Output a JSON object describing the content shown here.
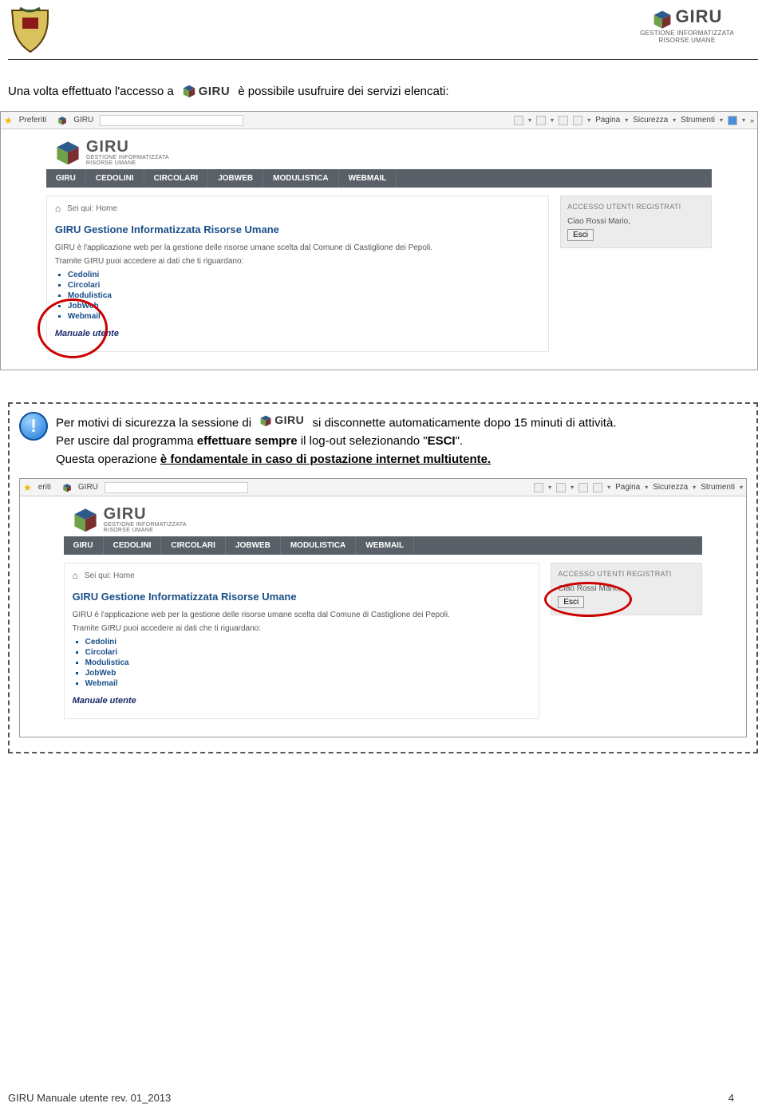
{
  "header": {
    "brand_title": "GIRU",
    "brand_sub1": "GESTIONE INFORMATIZZATA",
    "brand_sub2": "RISORSE UMANE"
  },
  "intro": {
    "part1": "Una volta effettuato l'accesso a",
    "part2": "è  possibile  usufruire  dei  servizi elencati:"
  },
  "screenshot": {
    "ie": {
      "preferiti": "Preferiti",
      "giru_tab": "GIRU",
      "pagina": "Pagina",
      "sicurezza": "Sicurezza",
      "strumenti": "Strumenti"
    },
    "nav": [
      "GIRU",
      "CEDOLINI",
      "CIRCOLARI",
      "JOBWEB",
      "MODULISTICA",
      "WEBMAIL"
    ],
    "breadcrumb": "Sei qui: Home",
    "heading": "GIRU Gestione Informatizzata Risorse Umane",
    "desc1": "GIRU è l'applicazione web per la gestione delle risorse umane scelta dal Comune di Castiglione dei Pepoli.",
    "desc2": "Tramite GIRU puoi accedere ai dati che ti riguardano:",
    "links": [
      "Cedolini",
      "Circolari",
      "Modulistica",
      "JobWeb",
      "Webmail"
    ],
    "manual": "Manuale utente",
    "sidebar": {
      "title": "ACCESSO UTENTI REGISTRATI",
      "greet": "Ciao Rossi Mario,",
      "logout": "Esci"
    }
  },
  "infobox": {
    "l1a": "Per motivi di sicurezza la sessione di ",
    "l1b": " si disconnette automaticamente dopo 15 minuti di attività.",
    "l2a": "Per uscire  dal  programma ",
    "l2b": "effettuare sempre",
    "l2c": "  il  log-out  selezionando  \"",
    "l2d": "ESCI",
    "l2e": "\".",
    "l3a": "Questa operazione ",
    "l3b": "è  fondamentale  in caso  di  postazione  internet  multiutente."
  },
  "footer": {
    "left": "GIRU Manuale utente rev. 01_2013",
    "right": "4"
  }
}
